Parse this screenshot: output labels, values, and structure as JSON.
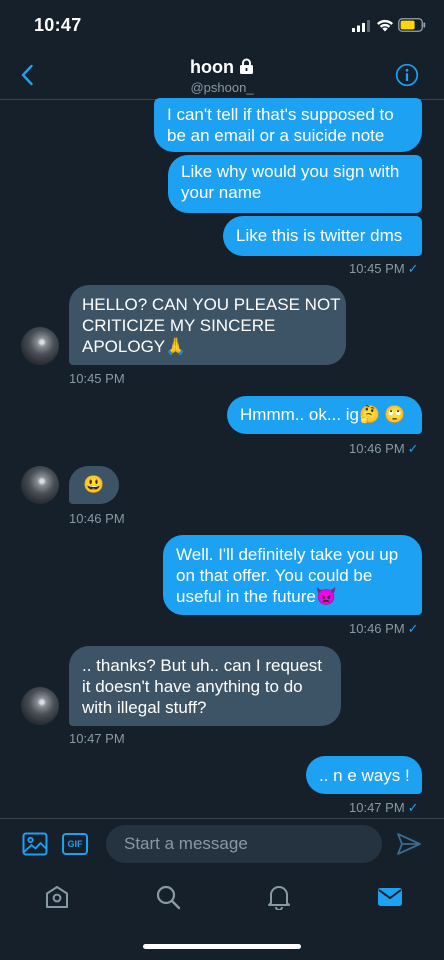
{
  "status": {
    "time": "10:47"
  },
  "header": {
    "name": "hoon",
    "handle": "@pshoon_"
  },
  "messages": {
    "m1": {
      "line1": "I can't tell if that's supposed to",
      "line2": "be an email or a suicide note"
    },
    "m2": {
      "line1": "Like why would you sign with",
      "line2": "your name"
    },
    "m3": {
      "line1": "Like this is twitter dms"
    },
    "t1": "10:45 PM",
    "m4": {
      "line1": "HELLO? CAN YOU PLEASE NOT",
      "line2": "CRITICIZE MY SINCERE",
      "line3": "APOLOGY"
    },
    "t2": "10:45 PM",
    "m5": {
      "text": "Hmmm.. ok... ig"
    },
    "t3": "10:46 PM",
    "t4": "10:46 PM",
    "m6": {
      "line1": "Well. I'll definitely take you up",
      "line2": "on that offer. You could be",
      "line3": "useful in the future"
    },
    "t5": "10:46 PM",
    "m7": {
      "line1": ".. thanks? But uh.. can I request",
      "line2": "it doesn't have anything to do",
      "line3": "with illegal stuff?"
    },
    "t6": "10:47 PM",
    "m8": {
      "text": ".. n e ways !"
    },
    "t7": "10:47 PM"
  },
  "emojis": {
    "pray": "🙏",
    "thinking": "🤔",
    "eye_roll": "🙄",
    "grin": "😃",
    "devil": "👿"
  },
  "composer": {
    "placeholder": "Start a message",
    "gif_label": "GIF"
  },
  "icons": [
    "back-icon",
    "lock-icon",
    "info-icon",
    "media-icon",
    "send-icon",
    "home-icon",
    "search-icon",
    "bell-icon",
    "mail-icon"
  ],
  "colors": {
    "background": "#15202b",
    "outgoing": "#1da1f2",
    "incoming": "#3d5466",
    "muted": "#8899a6"
  }
}
